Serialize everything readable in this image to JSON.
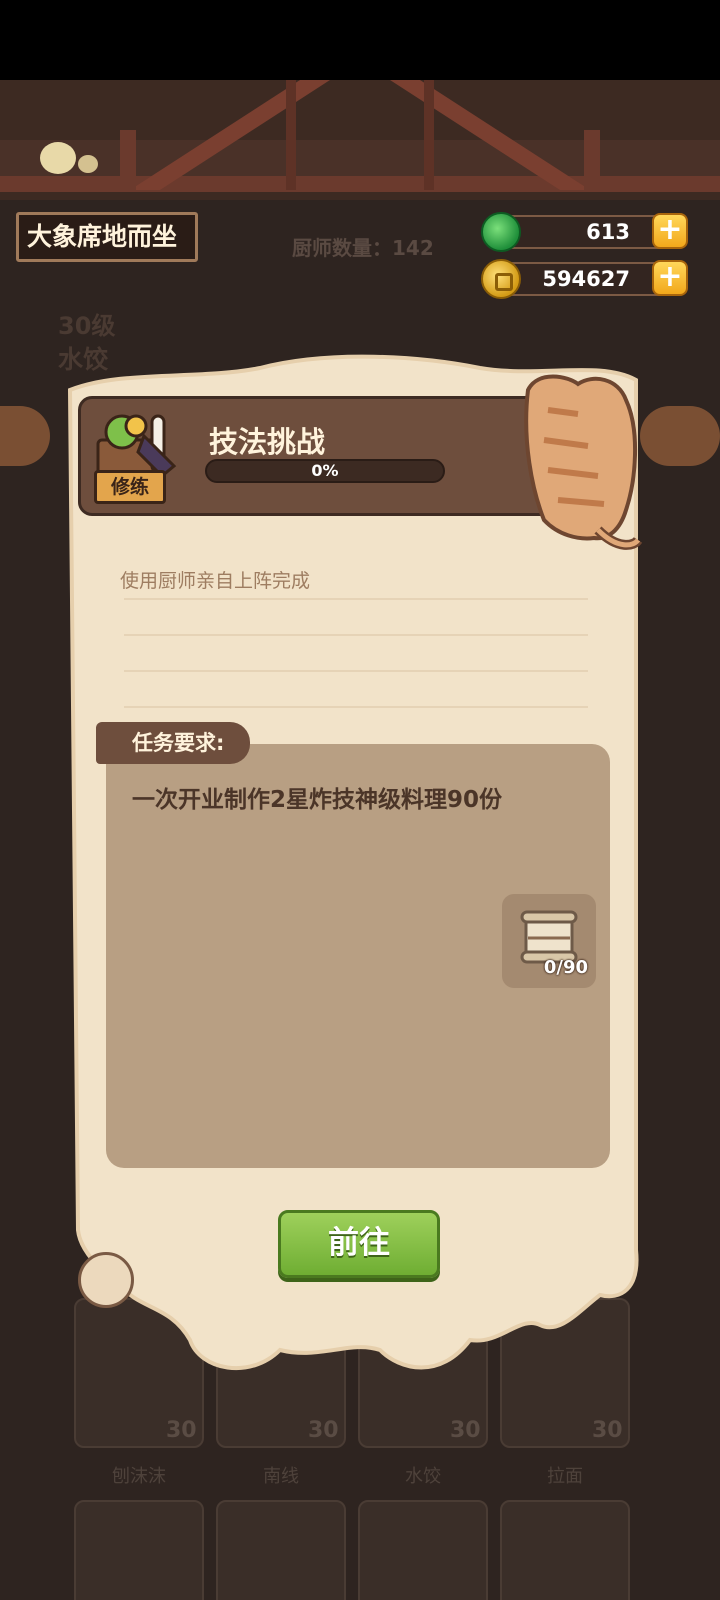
{
  "top_bar": {
    "player_name": "大象席地而坐",
    "chef_count": "厨师数量：142",
    "jade_amount": "613",
    "coin_amount": "594627",
    "plus_label": "+"
  },
  "background": {
    "level": "30级",
    "dish": "水饺",
    "cards": [
      {
        "level": "30",
        "name": "刨沫沫"
      },
      {
        "level": "30",
        "name": "南线"
      },
      {
        "level": "30",
        "name": "水饺"
      },
      {
        "level": "30",
        "name": "拉面"
      }
    ]
  },
  "dialog": {
    "badge": "修练",
    "title": "技法挑战",
    "progress_text": "0%",
    "progress_fraction": 0,
    "description": "使用厨师亲自上阵完成",
    "requirement_label": "任务要求:",
    "requirement_text": "一次开业制作2星炸技神级料理90份",
    "reward_count": "0/90",
    "go_button": "前往"
  },
  "icons": [
    "jade-icon",
    "coin-icon",
    "plus-icon",
    "ingredients-icon",
    "cat-icon",
    "scroll-icon"
  ],
  "colors": {
    "parchment": "#f2e3c9",
    "header": "#6e4e3d",
    "button_green": "#7dbb3c",
    "req_box": "#b89f83"
  }
}
